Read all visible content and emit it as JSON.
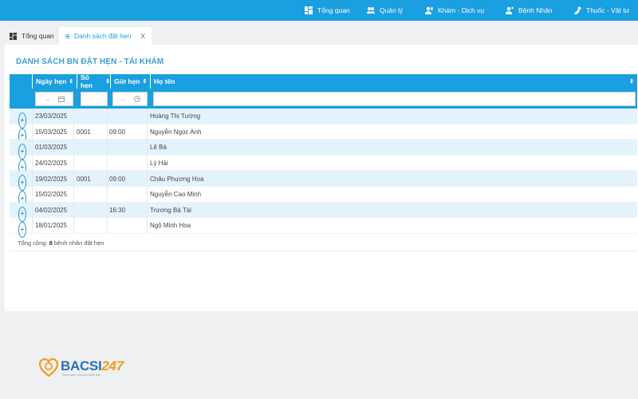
{
  "nav": {
    "items": [
      {
        "label": "Tổng quan",
        "icon": "dashboard-icon"
      },
      {
        "label": "Quản lý",
        "icon": "users-icon"
      },
      {
        "label": "Khám - Dịch vụ",
        "icon": "user-service-icon"
      },
      {
        "label": "Bệnh Nhân",
        "icon": "patient-icon"
      },
      {
        "label": "Thuốc - Vật tư",
        "icon": "medicine-icon"
      }
    ]
  },
  "tabs": [
    {
      "label": "Tổng quan",
      "icon": "dashboard-icon"
    },
    {
      "label": "Danh sách đặt hẹn",
      "icon": "list-icon",
      "close": "X"
    }
  ],
  "panel": {
    "title": "DANH SÁCH BN ĐẶT HẸN - TÁI KHÁM"
  },
  "table": {
    "columns": [
      "Ngày hẹn",
      "Số hẹn",
      "Giờ hẹn",
      "Họ tên"
    ],
    "filter_arrow": "→",
    "rows": [
      {
        "date": "23/03/2025",
        "num": "",
        "time": "",
        "name": "Hoàng Thị Tường"
      },
      {
        "date": "15/03/2025",
        "num": "0001",
        "time": "09:00",
        "name": "Nguyễn Ngọc Anh"
      },
      {
        "date": "01/03/2025",
        "num": "",
        "time": "",
        "name": "Lê Bá"
      },
      {
        "date": "24/02/2025",
        "num": "",
        "time": "",
        "name": "Lý Hải"
      },
      {
        "date": "19/02/2025",
        "num": "0001",
        "time": "09:00",
        "name": "Châu Phương Hoa"
      },
      {
        "date": "15/02/2025",
        "num": "",
        "time": "",
        "name": "Nguyễn Cao Minh"
      },
      {
        "date": "04/02/2025",
        "num": "",
        "time": "16:30",
        "name": "Trương Bá Tài"
      },
      {
        "date": "18/01/2025",
        "num": "",
        "time": "",
        "name": "Ngô Minh Hoa"
      }
    ]
  },
  "footer": {
    "prefix": "Tổng cộng:",
    "count": "8",
    "suffix": "bệnh nhân đặt hẹn"
  },
  "logo": {
    "text_main": "BACSI",
    "text_num": "247",
    "tagline": "Đồng hành cùng sức khỏe bạn"
  },
  "colors": {
    "accent": "#1a9fe0",
    "row_alt": "#e3f3fd",
    "logo_blue": "#2e6fb7",
    "logo_orange": "#f39a1e"
  }
}
